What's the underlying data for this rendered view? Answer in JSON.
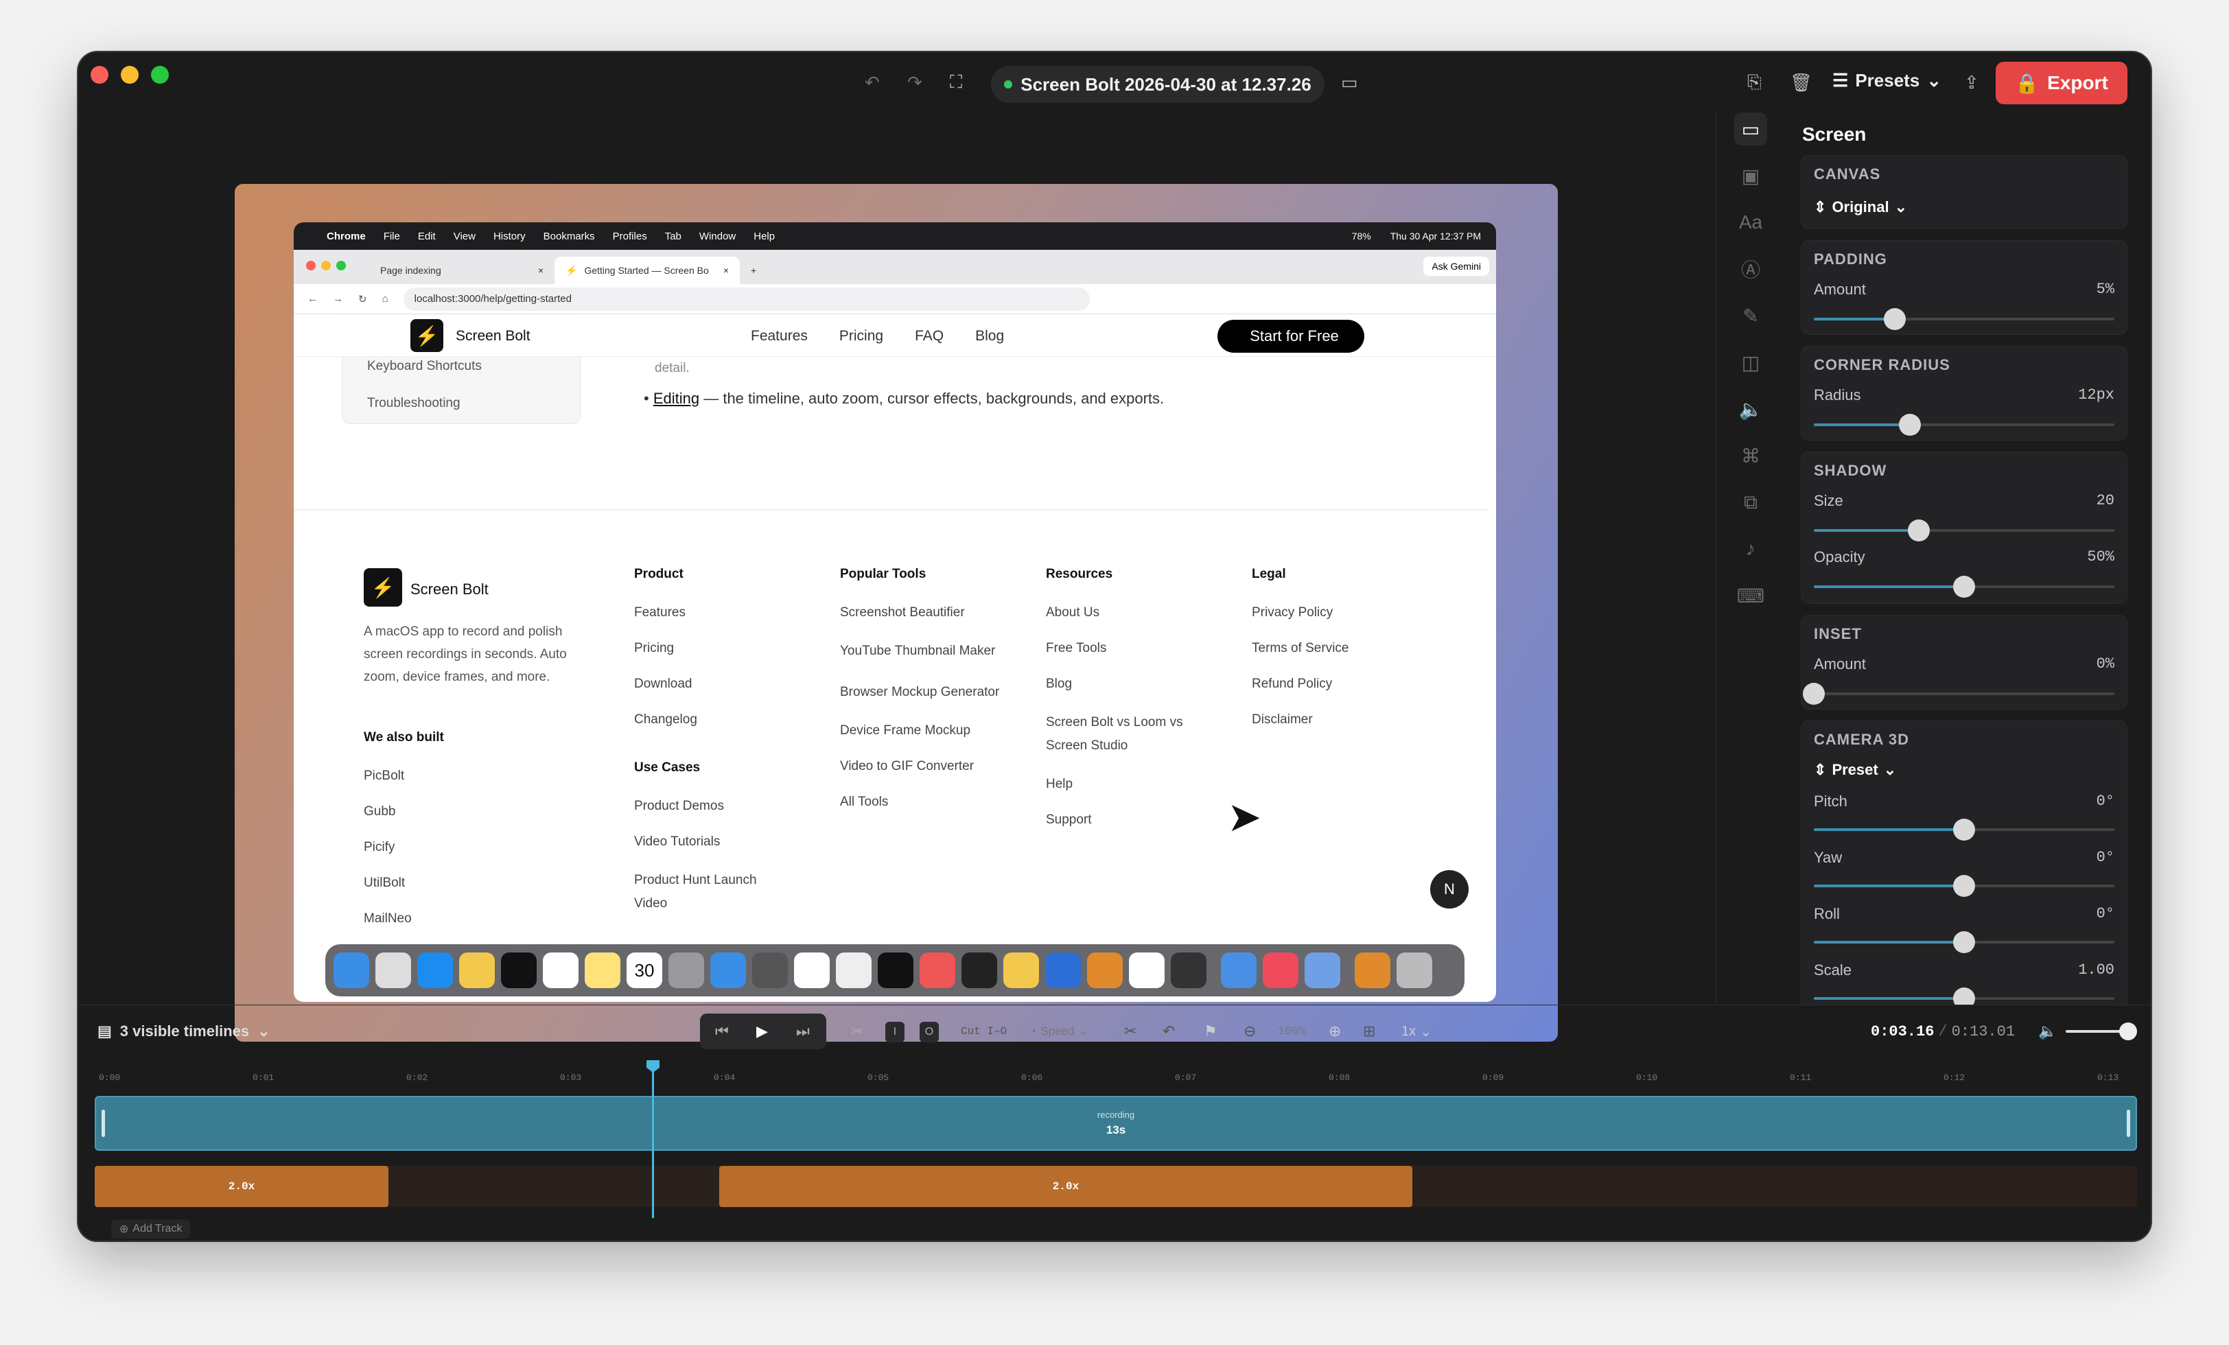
{
  "window": {
    "title": "Screen Bolt 2026-04-30 at 12.37.26",
    "presets": "Presets",
    "export": "Export"
  },
  "browser": {
    "menubar": {
      "app": "Chrome",
      "items": [
        "File",
        "Edit",
        "View",
        "History",
        "Bookmarks",
        "Profiles",
        "Tab",
        "Window",
        "Help"
      ],
      "battery": "78%",
      "datetime": "Thu 30 Apr  12:37 PM"
    },
    "tabs": [
      {
        "label": "Page indexing"
      },
      {
        "label": "Getting Started — Screen Bo"
      }
    ],
    "ask_gemini": "Ask Gemini",
    "url": "localhost:3000/help/getting-started"
  },
  "site": {
    "brand": "Screen Bolt",
    "nav": [
      "Features",
      "Pricing",
      "FAQ",
      "Blog"
    ],
    "cta": "Start for Free",
    "sidebar_items": [
      "Keyboard Shortcuts",
      "Troubleshooting"
    ],
    "detail_fragment": "detail.",
    "bullet_link": "Editing",
    "bullet_text": " — the timeline, auto zoom, cursor effects, backgrounds, and exports.",
    "footer": {
      "brand": "Screen Bolt",
      "description": "A macOS app to record and polish screen recordings in seconds. Auto zoom, device frames, and more.",
      "also_built_title": "We also built",
      "also_built": [
        "PicBolt",
        "Gubb",
        "Picify",
        "UtilBolt",
        "MailNeo"
      ],
      "product_title": "Product",
      "product": [
        "Features",
        "Pricing",
        "Download",
        "Changelog"
      ],
      "usecases_title": "Use Cases",
      "usecases": [
        "Product Demos",
        "Video Tutorials",
        "Product Hunt Launch Video"
      ],
      "tools_title": "Popular Tools",
      "tools": [
        "Screenshot Beautifier",
        "YouTube Thumbnail Maker",
        "Browser Mockup Generator",
        "Device Frame Mockup",
        "Video to GIF Converter",
        "All Tools"
      ],
      "resources_title": "Resources",
      "resources": [
        "About Us",
        "Free Tools",
        "Blog",
        "Screen Bolt vs Loom vs Screen Studio",
        "Help",
        "Support"
      ],
      "legal_title": "Legal",
      "legal": [
        "Privacy Policy",
        "Terms of Service",
        "Refund Policy",
        "Disclaimer"
      ],
      "avatar_letter": "N"
    },
    "dock_calendar_day": "30"
  },
  "panel": {
    "title": "Screen",
    "canvas": {
      "label": "CANVAS",
      "value": "Original"
    },
    "padding": {
      "label": "PADDING",
      "amount_label": "Amount",
      "amount": "5%",
      "level": 0.27
    },
    "corner": {
      "label": "CORNER RADIUS",
      "radius_label": "Radius",
      "radius": "12px",
      "level": 0.32
    },
    "shadow": {
      "label": "SHADOW",
      "size_label": "Size",
      "size": "20",
      "size_level": 0.35,
      "opacity_label": "Opacity",
      "opacity": "50%",
      "opacity_level": 0.5
    },
    "inset": {
      "label": "INSET",
      "amount_label": "Amount",
      "amount": "0%",
      "level": 0.0
    },
    "camera": {
      "label": "CAMERA 3D",
      "preset": "Preset",
      "pitch_label": "Pitch",
      "pitch": "0°",
      "yaw_label": "Yaw",
      "yaw": "0°",
      "roll_label": "Roll",
      "roll": "0°",
      "scale_label": "Scale",
      "scale": "1.00",
      "level": 0.5
    }
  },
  "timeline": {
    "visible": "3 visible timelines",
    "cut_label": "Cut I–O",
    "speed_label": "Speed",
    "zoom": "100%",
    "rate": "1x",
    "current": "0:03.16",
    "total": "0:13.01",
    "ticks": [
      "0:00",
      "0:01",
      "0:02",
      "0:03",
      "0:04",
      "0:05",
      "0:06",
      "0:07",
      "0:08",
      "0:09",
      "0:10",
      "0:11",
      "0:12",
      "0:13"
    ],
    "recording_label": "recording",
    "recording_duration": "13s",
    "speed_segments": [
      {
        "label": "2.0x"
      },
      {
        "label": "2.0x"
      }
    ],
    "add_track": "Add Track",
    "i_key": "I",
    "o_key": "O"
  }
}
